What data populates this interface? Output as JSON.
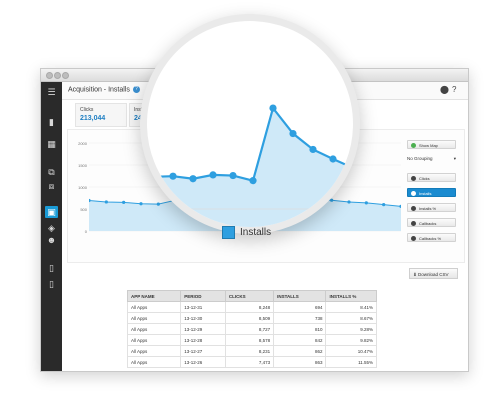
{
  "page": {
    "title": "Acquisition - Installs",
    "help_icon": "?"
  },
  "header_icons": {
    "user": "user-icon",
    "help": "?"
  },
  "sidebar": [
    {
      "icon": "menu-icon",
      "glyph": "☰"
    },
    {
      "icon": "bar-chart-icon",
      "glyph": "▮"
    },
    {
      "icon": "grid-icon",
      "glyph": "▦"
    },
    {
      "icon": "link-icon",
      "glyph": "⧉"
    },
    {
      "icon": "puzzle-icon",
      "glyph": "⧈"
    },
    {
      "icon": "window-icon",
      "glyph": "▣"
    },
    {
      "icon": "android-icon",
      "glyph": "◈"
    },
    {
      "icon": "users-icon",
      "glyph": "☻"
    },
    {
      "icon": "device-icon",
      "glyph": "▯"
    },
    {
      "icon": "phone-icon",
      "glyph": "▯"
    }
  ],
  "summary": {
    "clicks_label": "Clicks",
    "clicks_value": "213,044",
    "installs_label": "Installs",
    "installs_value": "24,8"
  },
  "chart_controls": {
    "show_map": "Show Map",
    "grouping": "No Grouping",
    "metrics": [
      "Clicks",
      "Installs",
      "Installs %",
      "Callbacks",
      "Callbacks %"
    ],
    "active_metric": "Installs"
  },
  "download_csv": "Download CSV",
  "chart_data": {
    "type": "area",
    "title": "",
    "xlabel": "",
    "ylabel": "",
    "yticks": [
      "2000",
      "1500",
      "1000",
      "500",
      "0"
    ],
    "ylim": [
      0,
      2000
    ],
    "series": [
      {
        "name": "Installs",
        "values": [
          694,
          660,
          650,
          620,
          610,
          700,
          760,
          735,
          900,
          860,
          820,
          790,
          760,
          720,
          700,
          660,
          640,
          600,
          560
        ]
      }
    ],
    "magnified_series": {
      "name": "Installs",
      "values": [
        820,
        830,
        790,
        850,
        840,
        760,
        1900,
        1500,
        1250,
        1100,
        960
      ]
    },
    "legend": [
      "Installs"
    ],
    "legend_position": "bottom",
    "grid": true
  },
  "table": {
    "columns": [
      "APP NAME",
      "PERIOD",
      "CLICKS",
      "INSTALLS",
      "INSTALLS %"
    ],
    "rows": [
      [
        "All Apps",
        "13-12-31",
        "8,248",
        "694",
        "8.41%"
      ],
      [
        "All Apps",
        "13-12-30",
        "8,509",
        "738",
        "8.67%"
      ],
      [
        "All Apps",
        "13-12-29",
        "8,727",
        "810",
        "9.28%"
      ],
      [
        "All Apps",
        "13-12-28",
        "8,578",
        "842",
        "9.82%"
      ],
      [
        "All Apps",
        "13-12-27",
        "8,231",
        "862",
        "10.47%"
      ],
      [
        "All Apps",
        "13-12-26",
        "7,473",
        "863",
        "11.55%"
      ]
    ]
  },
  "colors": {
    "accent": "#1a8bd0",
    "line": "#2e9fe0",
    "fill": "#cfe9f8",
    "sidebar": "#2a2a2a"
  }
}
